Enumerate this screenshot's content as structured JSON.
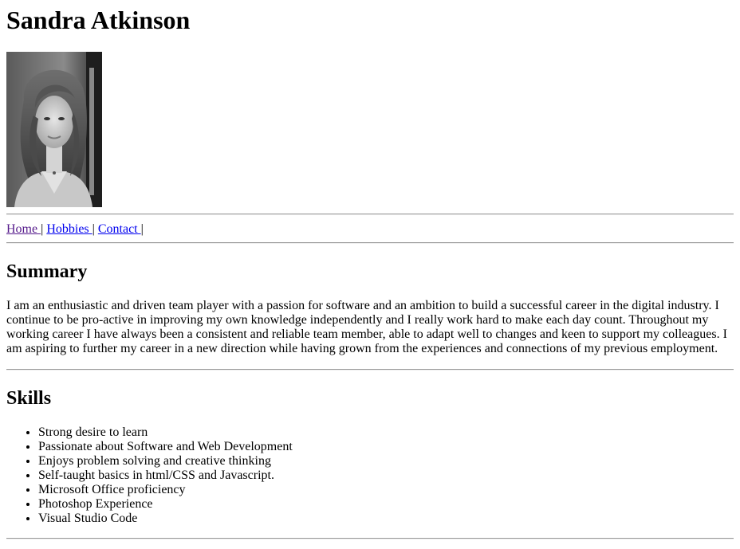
{
  "header": {
    "name": "Sandra Atkinson"
  },
  "photo": {
    "alt": "Portrait photo of Sandra Atkinson"
  },
  "nav": {
    "items": [
      {
        "label": "Home "
      },
      {
        "label": "Hobbies "
      },
      {
        "label": "Contact "
      }
    ],
    "separator": "|"
  },
  "summary": {
    "heading": "Summary",
    "text": "I am an enthusiastic and driven team player with a passion for software and an ambition to build a successful career in the digital industry. I continue to be pro-active in improving my own knowledge independently and I really work hard to make each day count. Throughout my working career I have always been a consistent and reliable team member, able to adapt well to changes and keen to support my colleagues. I am aspiring to further my career in a new direction while having grown from the experiences and connections of my previous employment."
  },
  "skills": {
    "heading": "Skills",
    "items": [
      "Strong desire to learn",
      "Passionate about Software and Web Development",
      "Enjoys problem solving and creative thinking",
      "Self-taught basics in html/CSS and Javascript.",
      "Microsoft Office proficiency",
      "Photoshop Experience",
      "Visual Studio Code"
    ]
  },
  "colors": {
    "link": "#0000ee",
    "visited_link": "#551a8b",
    "rule": "#9a9a9a"
  }
}
